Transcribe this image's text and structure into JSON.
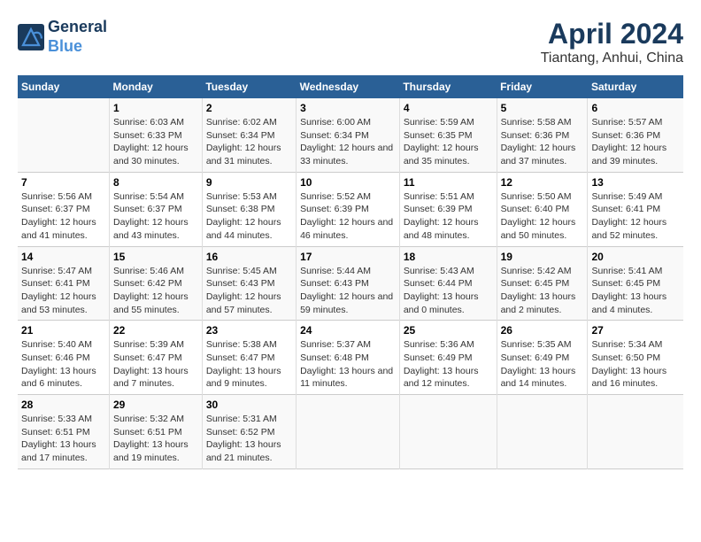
{
  "header": {
    "logo_line1": "General",
    "logo_line2": "Blue",
    "title": "April 2024",
    "subtitle": "Tiantang, Anhui, China"
  },
  "calendar": {
    "days_of_week": [
      "Sunday",
      "Monday",
      "Tuesday",
      "Wednesday",
      "Thursday",
      "Friday",
      "Saturday"
    ],
    "weeks": [
      [
        {
          "num": "",
          "sunrise": "",
          "sunset": "",
          "daylight": ""
        },
        {
          "num": "1",
          "sunrise": "Sunrise: 6:03 AM",
          "sunset": "Sunset: 6:33 PM",
          "daylight": "Daylight: 12 hours and 30 minutes."
        },
        {
          "num": "2",
          "sunrise": "Sunrise: 6:02 AM",
          "sunset": "Sunset: 6:34 PM",
          "daylight": "Daylight: 12 hours and 31 minutes."
        },
        {
          "num": "3",
          "sunrise": "Sunrise: 6:00 AM",
          "sunset": "Sunset: 6:34 PM",
          "daylight": "Daylight: 12 hours and 33 minutes."
        },
        {
          "num": "4",
          "sunrise": "Sunrise: 5:59 AM",
          "sunset": "Sunset: 6:35 PM",
          "daylight": "Daylight: 12 hours and 35 minutes."
        },
        {
          "num": "5",
          "sunrise": "Sunrise: 5:58 AM",
          "sunset": "Sunset: 6:36 PM",
          "daylight": "Daylight: 12 hours and 37 minutes."
        },
        {
          "num": "6",
          "sunrise": "Sunrise: 5:57 AM",
          "sunset": "Sunset: 6:36 PM",
          "daylight": "Daylight: 12 hours and 39 minutes."
        }
      ],
      [
        {
          "num": "7",
          "sunrise": "Sunrise: 5:56 AM",
          "sunset": "Sunset: 6:37 PM",
          "daylight": "Daylight: 12 hours and 41 minutes."
        },
        {
          "num": "8",
          "sunrise": "Sunrise: 5:54 AM",
          "sunset": "Sunset: 6:37 PM",
          "daylight": "Daylight: 12 hours and 43 minutes."
        },
        {
          "num": "9",
          "sunrise": "Sunrise: 5:53 AM",
          "sunset": "Sunset: 6:38 PM",
          "daylight": "Daylight: 12 hours and 44 minutes."
        },
        {
          "num": "10",
          "sunrise": "Sunrise: 5:52 AM",
          "sunset": "Sunset: 6:39 PM",
          "daylight": "Daylight: 12 hours and 46 minutes."
        },
        {
          "num": "11",
          "sunrise": "Sunrise: 5:51 AM",
          "sunset": "Sunset: 6:39 PM",
          "daylight": "Daylight: 12 hours and 48 minutes."
        },
        {
          "num": "12",
          "sunrise": "Sunrise: 5:50 AM",
          "sunset": "Sunset: 6:40 PM",
          "daylight": "Daylight: 12 hours and 50 minutes."
        },
        {
          "num": "13",
          "sunrise": "Sunrise: 5:49 AM",
          "sunset": "Sunset: 6:41 PM",
          "daylight": "Daylight: 12 hours and 52 minutes."
        }
      ],
      [
        {
          "num": "14",
          "sunrise": "Sunrise: 5:47 AM",
          "sunset": "Sunset: 6:41 PM",
          "daylight": "Daylight: 12 hours and 53 minutes."
        },
        {
          "num": "15",
          "sunrise": "Sunrise: 5:46 AM",
          "sunset": "Sunset: 6:42 PM",
          "daylight": "Daylight: 12 hours and 55 minutes."
        },
        {
          "num": "16",
          "sunrise": "Sunrise: 5:45 AM",
          "sunset": "Sunset: 6:43 PM",
          "daylight": "Daylight: 12 hours and 57 minutes."
        },
        {
          "num": "17",
          "sunrise": "Sunrise: 5:44 AM",
          "sunset": "Sunset: 6:43 PM",
          "daylight": "Daylight: 12 hours and 59 minutes."
        },
        {
          "num": "18",
          "sunrise": "Sunrise: 5:43 AM",
          "sunset": "Sunset: 6:44 PM",
          "daylight": "Daylight: 13 hours and 0 minutes."
        },
        {
          "num": "19",
          "sunrise": "Sunrise: 5:42 AM",
          "sunset": "Sunset: 6:45 PM",
          "daylight": "Daylight: 13 hours and 2 minutes."
        },
        {
          "num": "20",
          "sunrise": "Sunrise: 5:41 AM",
          "sunset": "Sunset: 6:45 PM",
          "daylight": "Daylight: 13 hours and 4 minutes."
        }
      ],
      [
        {
          "num": "21",
          "sunrise": "Sunrise: 5:40 AM",
          "sunset": "Sunset: 6:46 PM",
          "daylight": "Daylight: 13 hours and 6 minutes."
        },
        {
          "num": "22",
          "sunrise": "Sunrise: 5:39 AM",
          "sunset": "Sunset: 6:47 PM",
          "daylight": "Daylight: 13 hours and 7 minutes."
        },
        {
          "num": "23",
          "sunrise": "Sunrise: 5:38 AM",
          "sunset": "Sunset: 6:47 PM",
          "daylight": "Daylight: 13 hours and 9 minutes."
        },
        {
          "num": "24",
          "sunrise": "Sunrise: 5:37 AM",
          "sunset": "Sunset: 6:48 PM",
          "daylight": "Daylight: 13 hours and 11 minutes."
        },
        {
          "num": "25",
          "sunrise": "Sunrise: 5:36 AM",
          "sunset": "Sunset: 6:49 PM",
          "daylight": "Daylight: 13 hours and 12 minutes."
        },
        {
          "num": "26",
          "sunrise": "Sunrise: 5:35 AM",
          "sunset": "Sunset: 6:49 PM",
          "daylight": "Daylight: 13 hours and 14 minutes."
        },
        {
          "num": "27",
          "sunrise": "Sunrise: 5:34 AM",
          "sunset": "Sunset: 6:50 PM",
          "daylight": "Daylight: 13 hours and 16 minutes."
        }
      ],
      [
        {
          "num": "28",
          "sunrise": "Sunrise: 5:33 AM",
          "sunset": "Sunset: 6:51 PM",
          "daylight": "Daylight: 13 hours and 17 minutes."
        },
        {
          "num": "29",
          "sunrise": "Sunrise: 5:32 AM",
          "sunset": "Sunset: 6:51 PM",
          "daylight": "Daylight: 13 hours and 19 minutes."
        },
        {
          "num": "30",
          "sunrise": "Sunrise: 5:31 AM",
          "sunset": "Sunset: 6:52 PM",
          "daylight": "Daylight: 13 hours and 21 minutes."
        },
        {
          "num": "",
          "sunrise": "",
          "sunset": "",
          "daylight": ""
        },
        {
          "num": "",
          "sunrise": "",
          "sunset": "",
          "daylight": ""
        },
        {
          "num": "",
          "sunrise": "",
          "sunset": "",
          "daylight": ""
        },
        {
          "num": "",
          "sunrise": "",
          "sunset": "",
          "daylight": ""
        }
      ]
    ]
  }
}
